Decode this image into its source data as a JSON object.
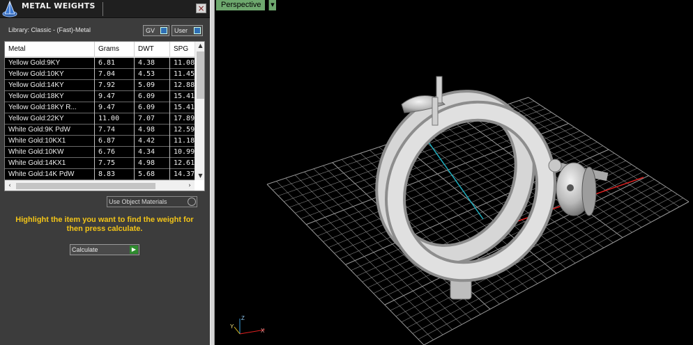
{
  "panel": {
    "title": "METAL WEIGHTS",
    "close_label": "×",
    "library_label": "Library: Classic - (Fast)-Metal",
    "toggles": [
      {
        "label": "GV"
      },
      {
        "label": "User"
      }
    ],
    "table": {
      "columns": [
        "Metal",
        "Grams",
        "DWT",
        "SPG"
      ],
      "rows": [
        [
          "Yellow Gold:9KY",
          "6.81",
          "4.38",
          "11.08"
        ],
        [
          "Yellow Gold:10KY",
          "7.04",
          "4.53",
          "11.45"
        ],
        [
          "Yellow Gold:14KY",
          "7.92",
          "5.09",
          "12.88"
        ],
        [
          "Yellow Gold:18KY",
          "9.47",
          "6.09",
          "15.41"
        ],
        [
          "Yellow Gold:18KY R...",
          "9.47",
          "6.09",
          "15.41"
        ],
        [
          "Yellow Gold:22KY",
          "11.00",
          "7.07",
          "17.89"
        ],
        [
          "White Gold:9K PdW",
          "7.74",
          "4.98",
          "12.59"
        ],
        [
          "White Gold:10KX1",
          "6.87",
          "4.42",
          "11.18"
        ],
        [
          "White Gold:10KW",
          "6.76",
          "4.34",
          "10.99"
        ],
        [
          "White Gold:14KX1",
          "7.75",
          "4.98",
          "12.61"
        ],
        [
          "White Gold:14K PdW",
          "8.83",
          "5.68",
          "14.37"
        ]
      ]
    },
    "use_object_materials": "Use Object Materials",
    "instruction": "Highlight the item you want to find the weight for then press calculate.",
    "calculate_label": "Calculate"
  },
  "viewport": {
    "view_label": "Perspective",
    "axis_labels": {
      "x": "X",
      "y": "Y",
      "z": "Z"
    }
  },
  "colors": {
    "instruction_text": "#f2c418",
    "viewport_tab": "#6ea86e",
    "grid_line": "#8a8a8a",
    "axis_x": "#e02020",
    "axis_y": "#20b0c0"
  }
}
